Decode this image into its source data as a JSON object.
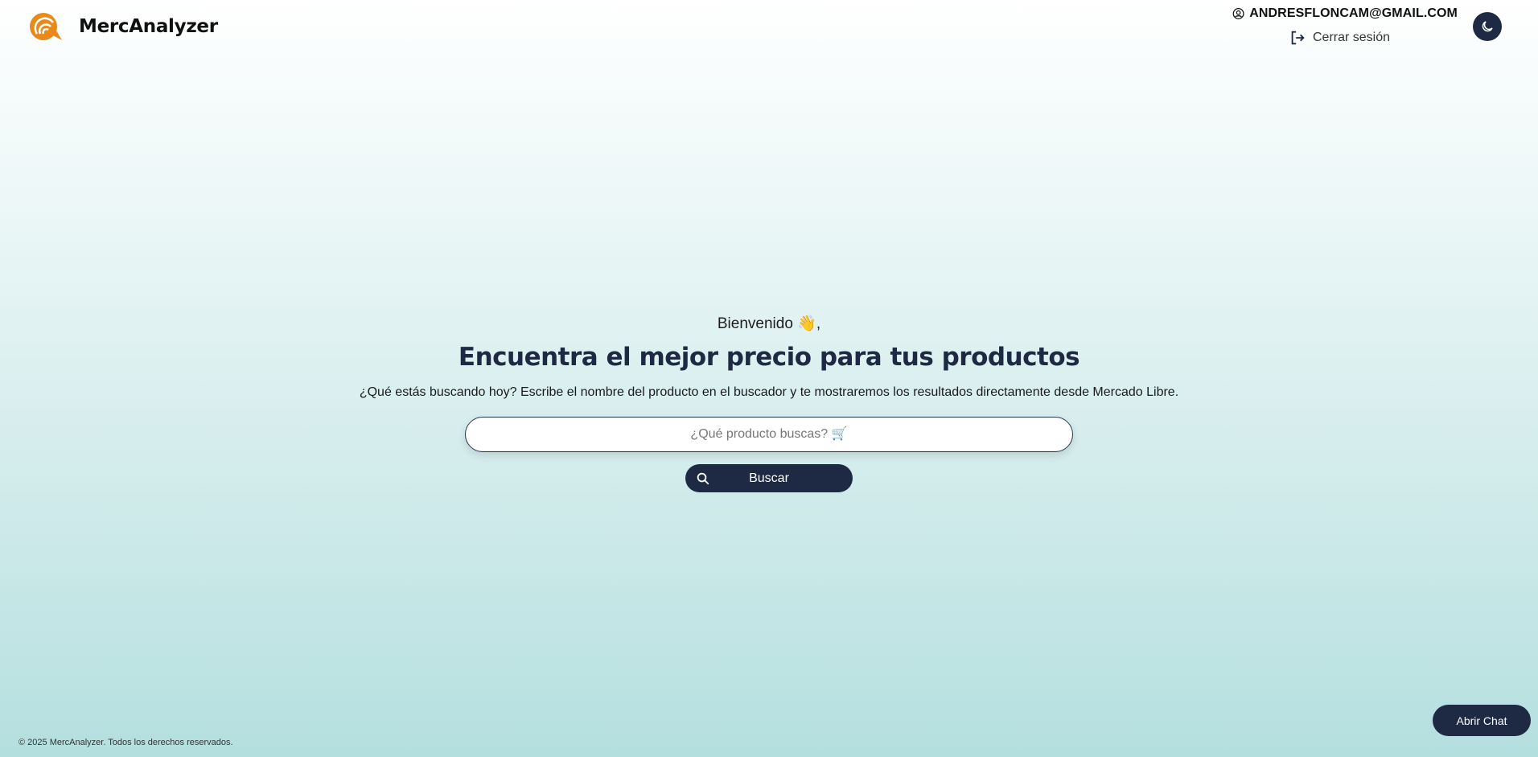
{
  "header": {
    "brand_name": "MercAnalyzer",
    "user_email": "ANDRESFLONCAM@GMAIL.COM",
    "logout_label": "Cerrar sesión",
    "logo_icon": "sound-wave-logo",
    "user_icon": "user-circle-icon",
    "logout_icon": "logout-icon",
    "theme_icon": "moon-icon"
  },
  "hero": {
    "welcome": "Bienvenido 👋,",
    "headline": "Encuentra el mejor precio para tus productos",
    "subtext": "¿Qué estás buscando hoy? Escribe el nombre del producto en el buscador y te mostraremos los resultados directamente desde Mercado Libre.",
    "search_placeholder": "¿Qué producto buscas? 🛒",
    "search_value": "",
    "search_button": "Buscar"
  },
  "footer": {
    "copyright": "© 2025 MercAnalyzer. Todos los derechos reservados."
  },
  "chat": {
    "label": "Abrir Chat"
  },
  "colors": {
    "primary": "#1e2a44",
    "logo_orange": "#e8891c",
    "bg_top": "#ffffff",
    "bg_bottom": "#b4dfdf"
  }
}
